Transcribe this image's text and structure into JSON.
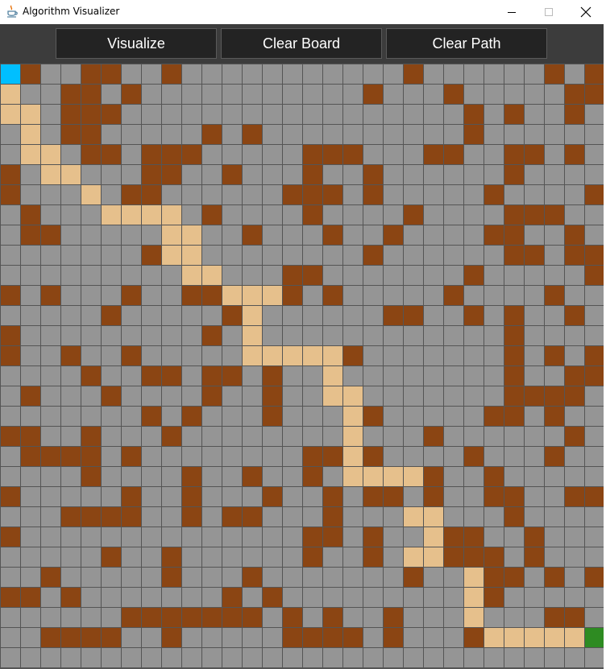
{
  "window": {
    "title": "Algorithm Visualizer",
    "icon": "java-cup-icon",
    "controls": [
      "minimize-icon",
      "maximize-icon",
      "close-icon"
    ]
  },
  "toolbar": {
    "visualize_label": "Visualize",
    "clear_board_label": "Clear Board",
    "clear_path_label": "Clear Path"
  },
  "colors": {
    "empty": "#959595",
    "wall": "#8b4513",
    "path": "#e6c08c",
    "start": "#00bfff",
    "end": "#2e8b22",
    "gridline": "#555555",
    "toolbar_bg": "#3c3c3c",
    "button_bg": "#232323"
  },
  "legend": {
    "0": "empty",
    "1": "wall",
    "2": "path",
    "3": "start",
    "4": "end"
  },
  "grid": {
    "rows": 30,
    "cols": 30,
    "cells": [
      "310011001000000000001000000101",
      "200110100000000000100010000011",
      "220111000000000000000001010010",
      "020110000010100000000001000000",
      "022011011100000111000110011010",
      "102200011001000100100000010000",
      "100020110000001110100000100001",
      "010002222010000100001000011100",
      "011000002200100010010000110010",
      "000000012200000000100000011011",
      "000000000220001100000001000001",
      "101000100112221010000010000100",
      "000001000001200000011001010010",
      "100000000010200000000000010000",
      "100100100000222221000000010101",
      "000010011011010020000000010011",
      "010001000010010022000000011110",
      "000000010100010002100000110100",
      "110010001000000002000100000010",
      "011110100000000112100001000100",
      "000010000100100102222100100000",
      "100000100100010010110100110011",
      "000111100101100010002200010000",
      "100000000000000110100211001000",
      "000001001000000100102211101000",
      "001000001000100000001002110101",
      "110100000001010000000002100000",
      "000000111111101010010002000110",
      "001111001000001111010001222224",
      "000000000000000000000000000000"
    ]
  }
}
